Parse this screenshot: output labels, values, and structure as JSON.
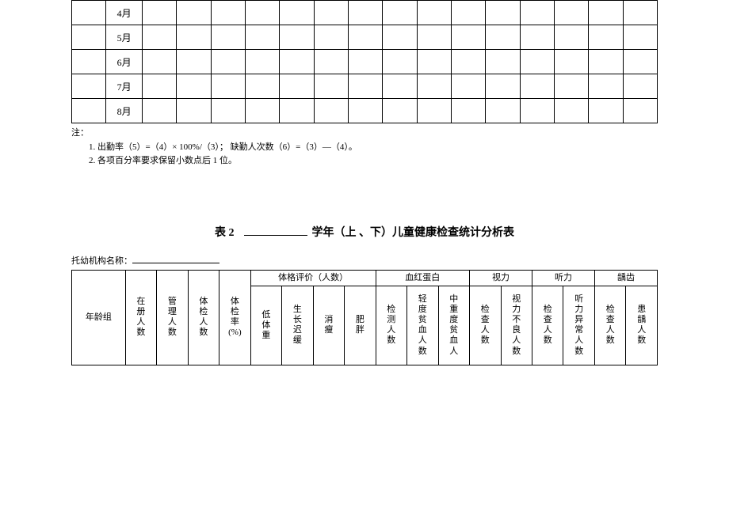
{
  "table1": {
    "months": [
      "4月",
      "5月",
      "6月",
      "7月",
      "8月"
    ]
  },
  "notes": {
    "label": "注：",
    "line1": "1. 出勤率（5）=（4）× 100%/（3）；  缺勤人次数（6）=（3）—（4）。",
    "line2": "2. 各项百分率要求保留小数点后 1 位。"
  },
  "table2": {
    "title_prefix": "表 2",
    "title_suffix": "学年（上 、下）儿童健康检查统计分析表",
    "org_label": "托幼机构名称：",
    "headers": {
      "age_group": "年龄组",
      "enrolled": "在册人数",
      "managed": "管理人数",
      "examined": "体检人数",
      "exam_rate": "体检率(%)",
      "physical": "体格评价（人数）",
      "low_weight": "低体重",
      "growth_slow": "生长迟缓",
      "thin": "消瘦",
      "obese": "肥胖",
      "hemoglobin": "血红蛋白",
      "test_count": "检测人数",
      "mild_anemia": "轻度贫血人数",
      "severe_anemia": "中重度贫血人",
      "vision": "视力",
      "vision_check": "检查人数",
      "vision_bad": "视力不良人数",
      "hearing": "听力",
      "hearing_check": "检查人数",
      "hearing_bad": "听力异常人数",
      "caries": "龋齿",
      "caries_check": "检查人数",
      "caries_count": "患龋人数"
    }
  }
}
